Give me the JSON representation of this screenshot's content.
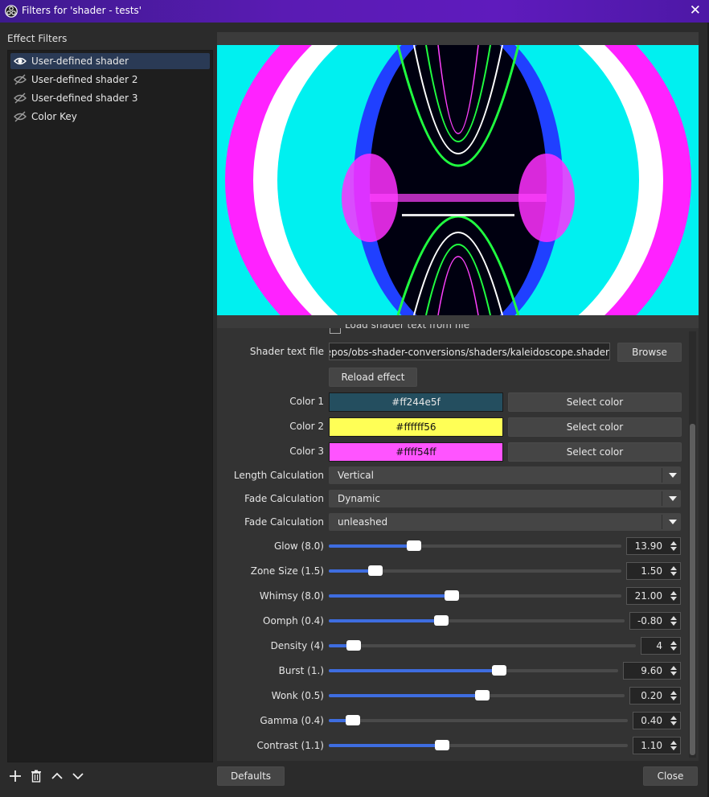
{
  "window": {
    "title": "Filters for 'shader - tests'"
  },
  "sidebar": {
    "section_label": "Effect Filters",
    "filters": [
      {
        "label": "User-defined shader",
        "visible": true,
        "selected": true
      },
      {
        "label": "User-defined shader 2",
        "visible": false,
        "selected": false
      },
      {
        "label": "User-defined shader 3",
        "visible": false,
        "selected": false
      },
      {
        "label": "Color Key",
        "visible": false,
        "selected": false
      }
    ],
    "tools": [
      "add-icon",
      "trash-icon",
      "move-up-icon",
      "move-down-icon"
    ]
  },
  "properties": {
    "load_from_file_label": "Load shader text from file",
    "shader_file": {
      "label": "Shader text file",
      "value": "/repos/obs-shader-conversions/shaders/kaleidoscope.shader",
      "browse_label": "Browse"
    },
    "reload_label": "Reload effect",
    "colors": [
      {
        "label": "Color 1",
        "value": "#ff244e5f",
        "swatch": "#244e5f",
        "text_color": "#e8e8e8",
        "button": "Select color"
      },
      {
        "label": "Color 2",
        "value": "#ffffff56",
        "swatch": "#ffff56",
        "text_color": "#111111",
        "button": "Select color"
      },
      {
        "label": "Color 3",
        "value": "#ffff54ff",
        "swatch": "#ff54ff",
        "text_color": "#111111",
        "button": "Select color"
      }
    ],
    "dropdowns": [
      {
        "label": "Length Calculation",
        "value": "Vertical"
      },
      {
        "label": "Fade Calculation",
        "value": "Dynamic"
      },
      {
        "label": "Fade Calculation",
        "value": "unleashed"
      }
    ],
    "sliders": [
      {
        "label": "Glow (8.0)",
        "value": "13.90",
        "fraction": 0.29
      },
      {
        "label": "Zone Size (1.5)",
        "value": "1.50",
        "fraction": 0.16
      },
      {
        "label": "Whimsy (8.0)",
        "value": "21.00",
        "fraction": 0.42
      },
      {
        "label": "Oomph (0.4)",
        "value": "-0.80",
        "fraction": 0.38
      },
      {
        "label": "Density (4)",
        "value": "4",
        "fraction": 0.08
      },
      {
        "label": "Burst (1.)",
        "value": "9.60",
        "fraction": 0.59
      },
      {
        "label": "Wonk (0.5)",
        "value": "0.20",
        "fraction": 0.52
      },
      {
        "label": "Gamma (0.4)",
        "value": "0.40",
        "fraction": 0.08
      },
      {
        "label": "Contrast (1.1)",
        "value": "1.10",
        "fraction": 0.38
      }
    ]
  },
  "footer": {
    "defaults_label": "Defaults",
    "close_label": "Close"
  },
  "colors": {
    "accent": "#3e6de0",
    "titlebar": "#5a1bb3",
    "selected_row": "#2a3a55"
  }
}
